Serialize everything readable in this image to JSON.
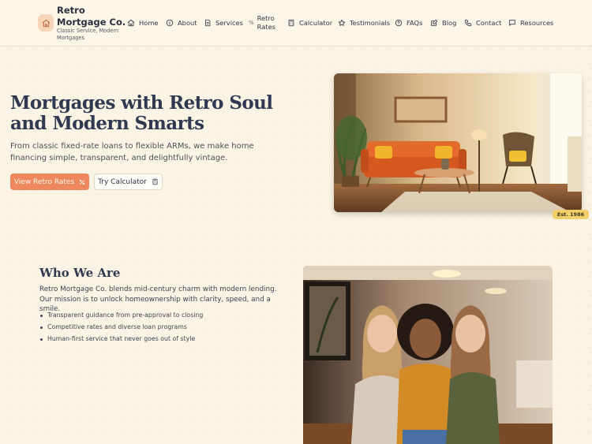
{
  "brand": {
    "name": "Retro Mortgage Co.",
    "tagline": "Classic Service, Modern Mortgages",
    "logo_icon": "home-icon"
  },
  "nav": {
    "items": [
      {
        "label": "Home",
        "icon": "home-icon"
      },
      {
        "label": "About",
        "icon": "info-icon"
      },
      {
        "label": "Services",
        "icon": "document-icon"
      },
      {
        "label": "Retro Rates",
        "icon": "percent-icon"
      },
      {
        "label": "Calculator",
        "icon": "calculator-icon"
      },
      {
        "label": "Testimonials",
        "icon": "star-icon"
      },
      {
        "label": "FAQs",
        "icon": "help-icon"
      },
      {
        "label": "Blog",
        "icon": "edit-icon"
      },
      {
        "label": "Contact",
        "icon": "phone-icon"
      },
      {
        "label": "Resources",
        "icon": "message-icon"
      }
    ]
  },
  "hero": {
    "title": "Mortgages with Retro Soul and Modern Smarts",
    "subtitle": "From classic fixed-rate loans to flexible ARMs, we make home financing simple, transparent, and delightfully vintage.",
    "primary_button": "View Retro Rates",
    "secondary_button": "Try Calculator",
    "badge": "Est. 1986"
  },
  "about": {
    "title": "Who We Are",
    "text": "Retro Mortgage Co. blends mid-century charm with modern lending. Our mission is to unlock homeownership with clarity, speed, and a smile.",
    "bullets": [
      "Transparent guidance from pre-approval to closing",
      "Competitive rates and diverse loan programs",
      "Human-first service that never goes out of style"
    ]
  },
  "colors": {
    "background": "#fbf4e4",
    "accent": "#ef875c",
    "badge": "#f2cf6c",
    "heading": "#2f3a52"
  }
}
